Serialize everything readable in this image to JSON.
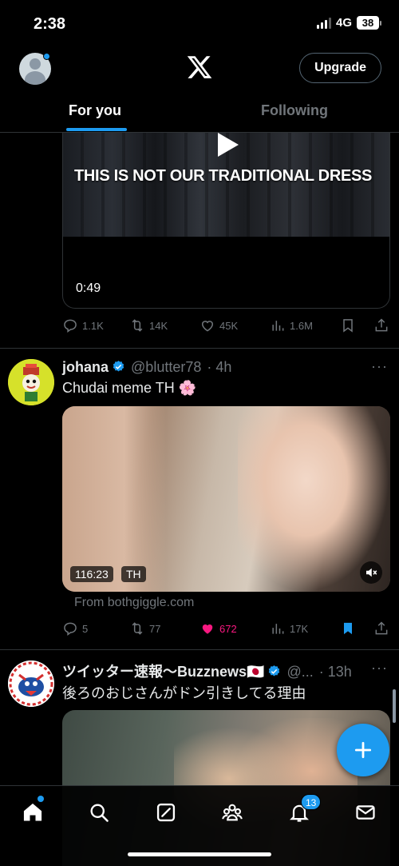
{
  "status_bar": {
    "time": "2:38",
    "network": "4G",
    "battery": "38"
  },
  "header": {
    "upgrade_label": "Upgrade"
  },
  "tabs": [
    {
      "label": "For you",
      "active": true
    },
    {
      "label": "Following",
      "active": false
    }
  ],
  "posts": [
    {
      "media": {
        "caption": "THIS IS NOT OUR TRADITIONAL DRESS",
        "duration": "0:49"
      },
      "stats": {
        "replies": "1.1K",
        "reposts": "14K",
        "likes": "45K",
        "views": "1.6M"
      }
    },
    {
      "author": "johana",
      "handle": "@blutter78",
      "time": "· 4h",
      "text": "Chudai meme TH 🌸",
      "media": {
        "duration": "116:23",
        "language": "TH"
      },
      "source": "From bothgiggle.com",
      "stats": {
        "replies": "5",
        "reposts": "77",
        "likes": "672",
        "views": "17K"
      },
      "liked": true,
      "bookmarked": true
    },
    {
      "author": "ツイッター速報〜Buzznews🇯🇵",
      "handle": "@...",
      "time": "· 13h",
      "text": "後ろのおじさんがドン引きしてる理由"
    }
  ],
  "nav": {
    "notifications_count": "13"
  },
  "colors": {
    "accent": "#1d9bf0",
    "like": "#f91880",
    "muted": "#71767b",
    "divider": "#2f3336"
  },
  "icons": [
    "x-logo-icon",
    "verified-icon",
    "reply-icon",
    "repost-icon",
    "like-icon",
    "views-icon",
    "bookmark-icon",
    "share-icon",
    "play-icon",
    "mute-icon",
    "compose-plus-icon",
    "home-icon",
    "search-icon",
    "grok-icon",
    "communities-icon",
    "bell-icon",
    "mail-icon"
  ]
}
